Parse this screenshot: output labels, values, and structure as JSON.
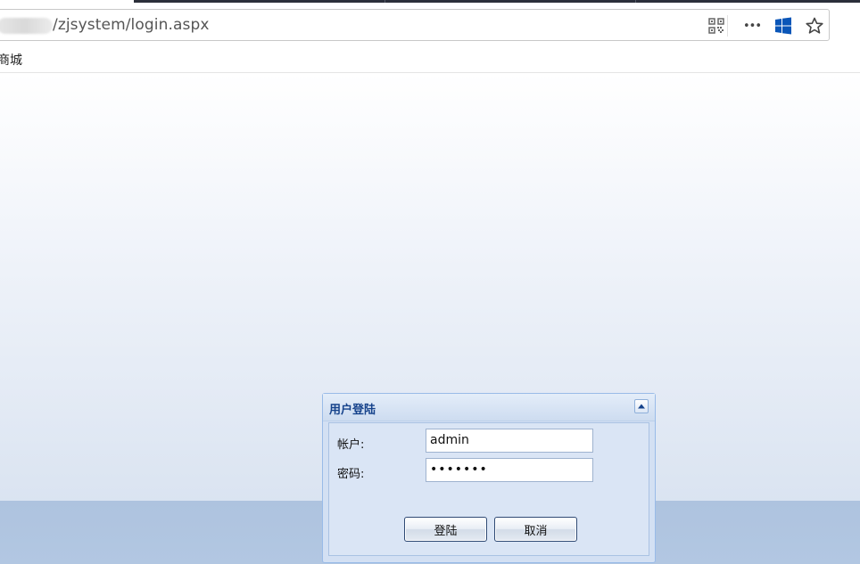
{
  "browser": {
    "url": "/zjsystem/login.aspx",
    "icons": [
      "qr-code-icon",
      "more-icon",
      "windows-icon",
      "star-icon"
    ],
    "more_label": "•••"
  },
  "bookmarks": {
    "items": [
      {
        "label": "商城"
      }
    ]
  },
  "dialog": {
    "title": "用户登陆",
    "username_label": "帐户:",
    "username_value": "admin",
    "password_label": "密码:",
    "password_value": "•••••••",
    "login_button": "登陆",
    "cancel_button": "取消"
  },
  "colors": {
    "dialog_title": "#15428b",
    "dialog_border": "#99bbe8",
    "page_band": "#aec3df"
  }
}
